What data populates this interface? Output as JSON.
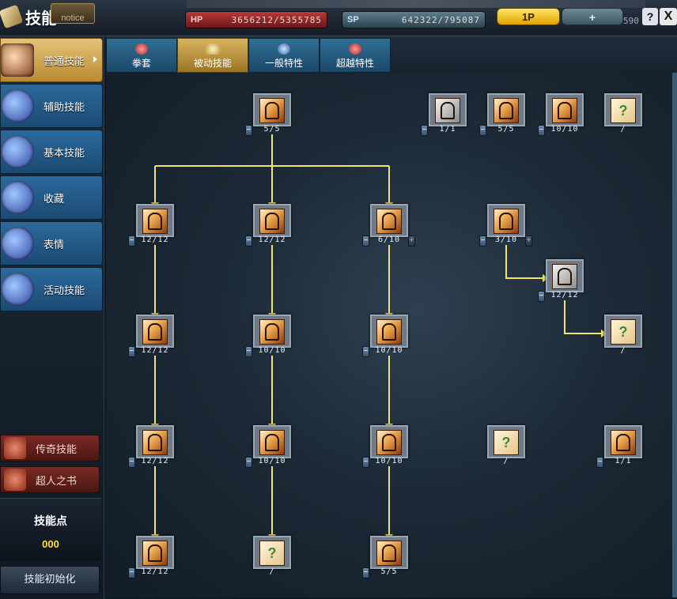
{
  "window": {
    "title": "技能",
    "notice": "notice"
  },
  "hud": {
    "hp_label": "HP",
    "hp_value": "3656212/5355785",
    "sp_label": "SP",
    "sp_value": "642322/795087",
    "player_button": "1P",
    "add_button": "+",
    "right_number": "590",
    "help": "?",
    "close": "X"
  },
  "categories": [
    {
      "label": "普通技能",
      "active": true
    },
    {
      "label": "辅助技能"
    },
    {
      "label": "基本技能"
    },
    {
      "label": "收藏"
    },
    {
      "label": "表情"
    },
    {
      "label": "活动技能"
    }
  ],
  "side_buttons": {
    "legend": "传奇技能",
    "superman": "超人之书"
  },
  "skill_points": {
    "title": "技能点",
    "value": "000"
  },
  "reset_button": "技能初始化",
  "tabs": [
    {
      "label": "拳套"
    },
    {
      "label": "被动技能",
      "active": true
    },
    {
      "label": "一般特性"
    },
    {
      "label": "超越特性"
    }
  ],
  "skills": [
    {
      "id": "s1",
      "level": "5/5",
      "col": 1,
      "row": 0,
      "minus": true
    },
    {
      "id": "s2",
      "level": "1/1",
      "col": "r1",
      "row": 0,
      "minus": true,
      "grey": true
    },
    {
      "id": "s3",
      "level": "5/5",
      "col": "r2",
      "row": 0,
      "minus": true
    },
    {
      "id": "s4",
      "level": "10/10",
      "col": "r3",
      "row": 0,
      "minus": true
    },
    {
      "id": "s5",
      "level": "/",
      "col": "r4",
      "row": 0,
      "q": true
    },
    {
      "id": "s6",
      "level": "12/12",
      "col": 0,
      "row": 1,
      "minus": true
    },
    {
      "id": "s7",
      "level": "12/12",
      "col": 1,
      "row": 1,
      "minus": true
    },
    {
      "id": "s8",
      "level": "6/10",
      "col": 2,
      "row": 1,
      "minus": true,
      "plus": true
    },
    {
      "id": "s9",
      "level": "3/10",
      "col": 3,
      "row": 1,
      "minus": true,
      "plus": true
    },
    {
      "id": "s10",
      "level": "12/12",
      "col": "m",
      "row": 1.5,
      "minus": true,
      "grey": true
    },
    {
      "id": "s11",
      "level": "12/12",
      "col": 0,
      "row": 2,
      "minus": true
    },
    {
      "id": "s12",
      "level": "10/10",
      "col": 1,
      "row": 2,
      "minus": true
    },
    {
      "id": "s13",
      "level": "10/10",
      "col": 2,
      "row": 2,
      "minus": true
    },
    {
      "id": "s14",
      "level": "/",
      "col": 4,
      "row": 2,
      "q": true
    },
    {
      "id": "s15",
      "level": "12/12",
      "col": 0,
      "row": 3,
      "minus": true
    },
    {
      "id": "s16",
      "level": "10/10",
      "col": 1,
      "row": 3,
      "minus": true
    },
    {
      "id": "s17",
      "level": "10/10",
      "col": 2,
      "row": 3,
      "minus": true
    },
    {
      "id": "s18",
      "level": "/",
      "col": 3,
      "row": 3,
      "q": true
    },
    {
      "id": "s19",
      "level": "1/1",
      "col": 4,
      "row": 3,
      "minus": true
    },
    {
      "id": "s20",
      "level": "12/12",
      "col": 0,
      "row": 4,
      "minus": true
    },
    {
      "id": "s21",
      "level": "/",
      "col": 1,
      "row": 4,
      "q": true
    },
    {
      "id": "s22",
      "level": "5/5",
      "col": 2,
      "row": 4,
      "minus": true
    }
  ]
}
